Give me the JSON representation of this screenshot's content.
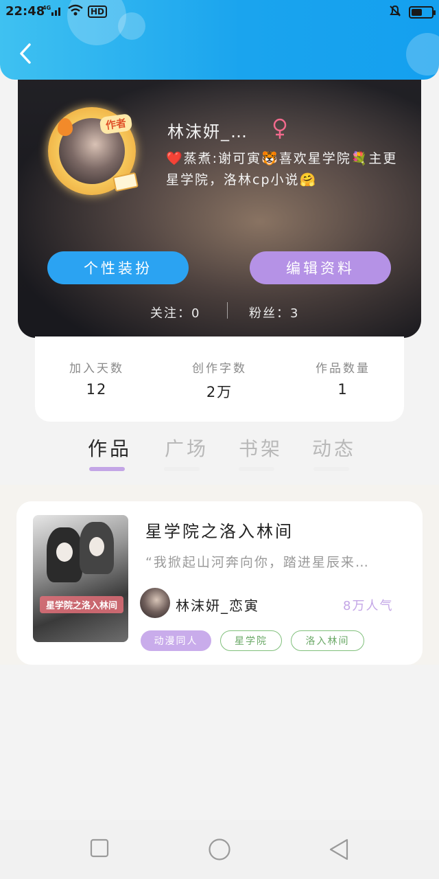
{
  "status_bar": {
    "time": "22:48",
    "network": "4G",
    "hd": "HD",
    "battery_level": 0.55
  },
  "header": {
    "back_icon": "chevron-left-icon",
    "accent_color": "#1aa4ee"
  },
  "profile": {
    "badge": "作者",
    "name": "林沫妍_…",
    "gender_icon": "female-icon",
    "bio": "❤️蒸煮:谢可寅🐯喜欢星学院💐主更星学院，洛林cp小说🤗",
    "buttons": {
      "dress_up": "个性装扮",
      "edit_profile": "编辑资料"
    },
    "follow": {
      "following": "关注：0",
      "fans": "粉丝：3"
    }
  },
  "stats": [
    {
      "label": "加入天数",
      "value": "12"
    },
    {
      "label": "创作字数",
      "value": "2万"
    },
    {
      "label": "作品数量",
      "value": "1"
    }
  ],
  "tabs": [
    {
      "label": "作品",
      "active": true
    },
    {
      "label": "广场",
      "active": false
    },
    {
      "label": "书架",
      "active": false
    },
    {
      "label": "动态",
      "active": false
    }
  ],
  "works": [
    {
      "cover_text": "星学院之洛入林间",
      "title": "星学院之洛入林间",
      "excerpt": "“我掀起山河奔向你，踏进星辰来…",
      "author": "林沫妍_恋寅",
      "popularity": "8万人气",
      "tags": [
        "动漫同人",
        "星学院",
        "洛入林间"
      ]
    }
  ],
  "nav": {
    "recent_icon": "square-icon",
    "home_icon": "circle-icon",
    "back_icon": "triangle-back-icon"
  }
}
